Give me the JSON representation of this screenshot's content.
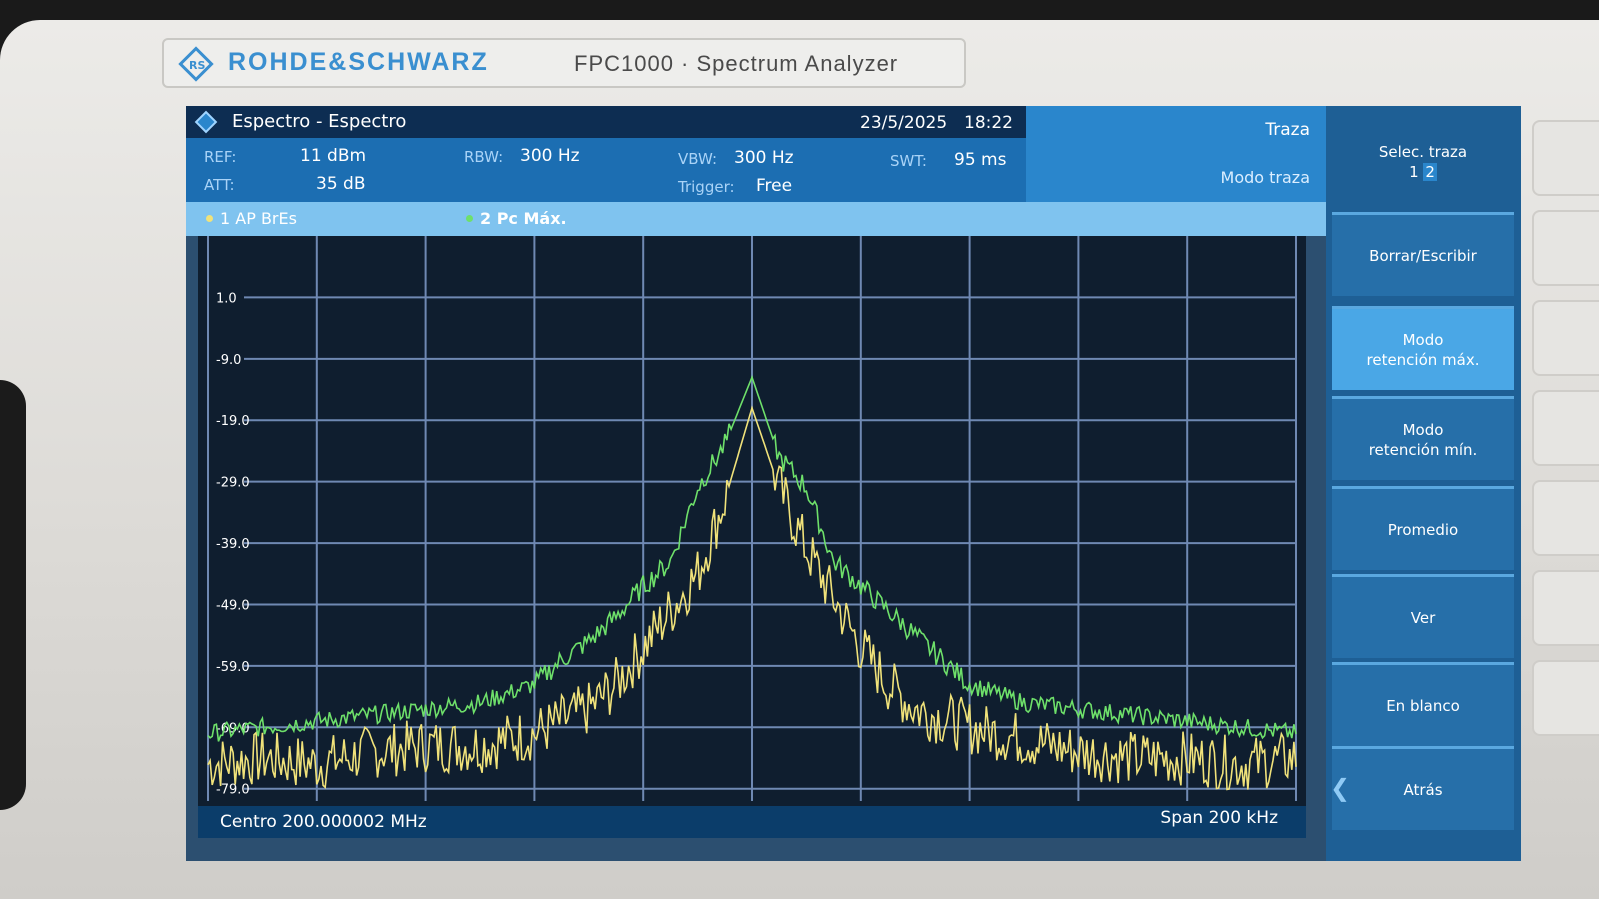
{
  "device": {
    "brand": "ROHDE&SCHWARZ",
    "model": "FPC1000 · Spectrum Analyzer"
  },
  "titlebar": {
    "title": "Espectro - Espectro",
    "date": "23/5/2025",
    "time": "18:22"
  },
  "settings": {
    "ref_label": "REF:",
    "ref_value": "11 dBm",
    "att_label": "ATT:",
    "att_value": "35 dB",
    "rbw_label": "RBW:",
    "rbw_value": "300 Hz",
    "vbw_label": "VBW:",
    "vbw_value": "300 Hz",
    "trigger_label": "Trigger:",
    "trigger_value": "Free",
    "swt_label": "SWT:",
    "swt_value": "95 ms"
  },
  "trace_panel": {
    "header": "Traza",
    "mode_label": "Modo traza"
  },
  "legend": {
    "trace1": "1 AP BrEs",
    "trace2": "2 Pc Máx."
  },
  "bottombar": {
    "center": "Centro 200.000002 MHz",
    "span": "Span 200 kHz"
  },
  "softkeys": {
    "select_trace_label": "Selec. traza",
    "select_trace_1": "1",
    "select_trace_2": "2",
    "clear_write": "Borrar/Escribir",
    "max_hold_1": "Modo",
    "max_hold_2": "retención máx.",
    "min_hold_1": "Modo",
    "min_hold_2": "retención mín.",
    "average": "Promedio",
    "view": "Ver",
    "blank": "En blanco",
    "back": "Atrás"
  },
  "colors": {
    "trace1": "#f0e27a",
    "trace2": "#6ee06a",
    "grid": "#6f89b3",
    "active_softkey": "#4aa7e6"
  },
  "chart_data": {
    "type": "line",
    "x_axis": "frequency",
    "x_center": "Centro 200.000002 MHz",
    "x_span": "Span 200 kHz",
    "ylim": [
      -81.0,
      11.0
    ],
    "yticks": [
      "1.0",
      "-9.0",
      "-19.0",
      "-29.0",
      "-39.0",
      "-49.0",
      "-59.0",
      "-69.0",
      "-79.0"
    ],
    "grid": true,
    "series": [
      {
        "name": "2 Pc Máx.",
        "color": "#6ee06a",
        "x": [
          -100,
          -90,
          -80,
          -70,
          -60,
          -50,
          -40,
          -35,
          -30,
          -25,
          -20,
          -15,
          -10,
          -5,
          0,
          5,
          10,
          15,
          20,
          25,
          30,
          35,
          40,
          50,
          60,
          70,
          80,
          90,
          100
        ],
        "values": [
          -70,
          -69,
          -68,
          -67,
          -66,
          -65,
          -62,
          -58,
          -55,
          -51,
          -46,
          -42,
          -30,
          -23,
          -12,
          -25,
          -30,
          -42,
          -46,
          -50,
          -54,
          -58,
          -62,
          -65,
          -66,
          -67,
          -68,
          -69,
          -70
        ]
      },
      {
        "name": "1 AP BrEs",
        "color": "#f0e27a",
        "x": [
          -100,
          -90,
          -80,
          -70,
          -60,
          -50,
          -40,
          -30,
          -25,
          -20,
          -15,
          -10,
          -5,
          0,
          5,
          10,
          15,
          20,
          25,
          30,
          40,
          50,
          60,
          70,
          80,
          90,
          100
        ],
        "values": [
          -75,
          -74,
          -75,
          -73,
          -72,
          -72,
          -70,
          -66,
          -62,
          -56,
          -50,
          -44,
          -32,
          -17,
          -30,
          -40,
          -48,
          -56,
          -62,
          -66,
          -69,
          -71,
          -73,
          -74,
          -74,
          -75,
          -74
        ]
      }
    ]
  }
}
